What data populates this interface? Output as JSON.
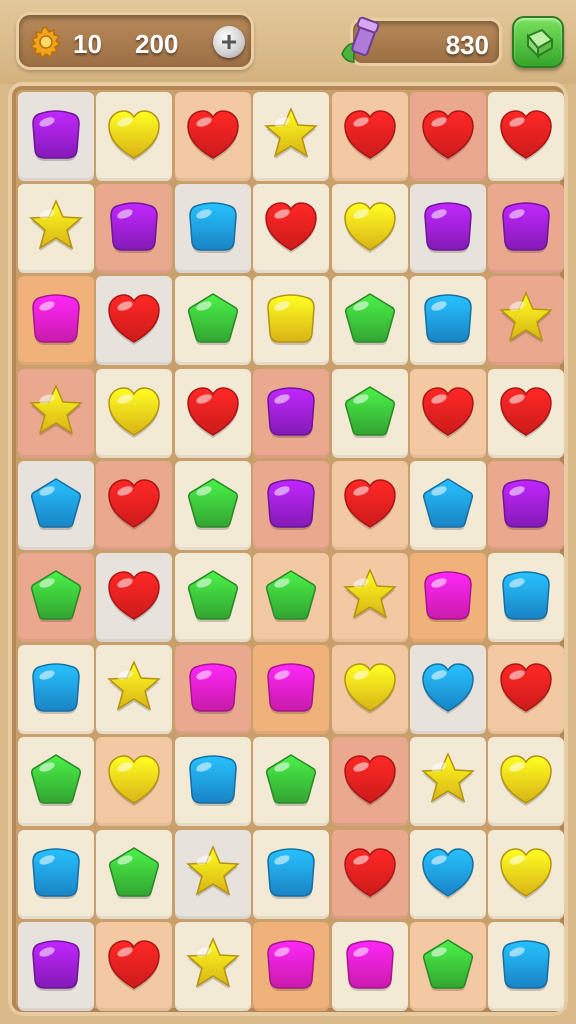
{
  "hud": {
    "lives": "10",
    "coins": "200",
    "add_label": "+",
    "score": "830"
  },
  "colors": {
    "purple": "#9b1fd6",
    "yellow": "#ffd21a",
    "red": "#f0201e",
    "blue": "#1f9be8",
    "green": "#3cc23a",
    "magenta": "#ec1fc8",
    "tile_light": "#f3ead6",
    "tile_peach": "#f2c9a2",
    "tile_orange": "#f0b27a",
    "tile_salmon": "#eaa88f",
    "tile_gray": "#e8e2dc"
  },
  "board": {
    "rows": 10,
    "cols": 7,
    "candies": [
      [
        "purple-square",
        "yellow-heart",
        "red-heart",
        "yellow-star",
        "red-heart",
        "red-heart",
        "red-heart"
      ],
      [
        "yellow-star",
        "purple-square",
        "blue-square",
        "red-heart",
        "yellow-heart",
        "purple-square",
        "purple-square"
      ],
      [
        "magenta-square",
        "red-heart",
        "green-pentagon",
        "yellow-square",
        "green-pentagon",
        "blue-square",
        "yellow-star"
      ],
      [
        "yellow-star",
        "yellow-heart",
        "red-heart",
        "purple-square",
        "green-pentagon",
        "red-heart",
        "red-heart"
      ],
      [
        "blue-pentagon",
        "red-heart",
        "green-pentagon",
        "purple-square",
        "red-heart",
        "blue-pentagon",
        "purple-square"
      ],
      [
        "green-pentagon",
        "red-heart",
        "green-pentagon",
        "green-pentagon",
        "yellow-star",
        "magenta-square",
        "blue-square"
      ],
      [
        "blue-square",
        "yellow-star",
        "magenta-square",
        "magenta-square",
        "yellow-heart",
        "blue-heart",
        "red-heart"
      ],
      [
        "green-pentagon",
        "yellow-heart",
        "blue-square",
        "green-pentagon",
        "red-heart",
        "yellow-star",
        "yellow-heart"
      ],
      [
        "blue-square",
        "green-pentagon",
        "yellow-star",
        "blue-square",
        "red-heart",
        "blue-heart",
        "yellow-heart"
      ],
      [
        "purple-square",
        "red-heart",
        "yellow-star",
        "magenta-square",
        "magenta-square",
        "green-pentagon",
        "blue-square"
      ]
    ],
    "tiles": [
      [
        "gray",
        "light",
        "peach",
        "light",
        "peach",
        "salmon",
        "light"
      ],
      [
        "light",
        "salmon",
        "gray",
        "light",
        "light",
        "gray",
        "salmon"
      ],
      [
        "orange",
        "gray",
        "light",
        "light",
        "light",
        "light",
        "salmon"
      ],
      [
        "salmon",
        "light",
        "light",
        "salmon",
        "light",
        "peach",
        "light"
      ],
      [
        "gray",
        "salmon",
        "light",
        "salmon",
        "peach",
        "light",
        "salmon"
      ],
      [
        "salmon",
        "gray",
        "light",
        "peach",
        "peach",
        "orange",
        "light"
      ],
      [
        "light",
        "light",
        "salmon",
        "orange",
        "peach",
        "gray",
        "peach"
      ],
      [
        "light",
        "peach",
        "light",
        "light",
        "salmon",
        "light",
        "light"
      ],
      [
        "light",
        "light",
        "gray",
        "light",
        "salmon",
        "light",
        "light"
      ],
      [
        "gray",
        "peach",
        "light",
        "orange",
        "light",
        "peach",
        "light"
      ]
    ]
  }
}
